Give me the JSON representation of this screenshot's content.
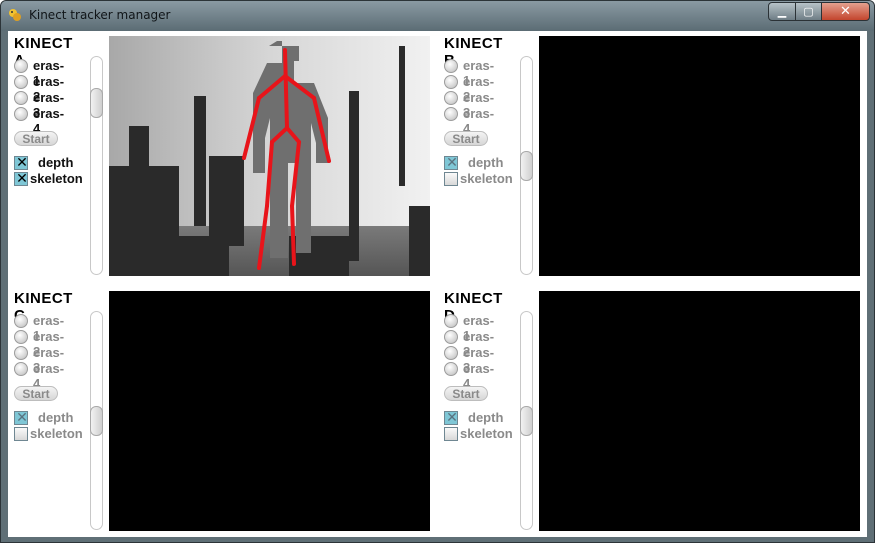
{
  "window": {
    "title": "Kinect tracker manager"
  },
  "controls": {
    "minimize": "▁",
    "maximize": "▢",
    "close": "✕"
  },
  "panels": [
    {
      "title": "KINECT A",
      "eras": [
        "eras-1",
        "eras-2",
        "eras-3",
        "eras-4"
      ],
      "start": "Start",
      "depth": "depth",
      "skeleton": "skeleton",
      "depth_checked": true,
      "skeleton_checked": true,
      "active": true
    },
    {
      "title": "KINECT B",
      "eras": [
        "eras-1",
        "eras-2",
        "eras-3",
        "eras-4"
      ],
      "start": "Start",
      "depth": "depth",
      "skeleton": "skeleton",
      "depth_checked": true,
      "skeleton_checked": false,
      "active": false
    },
    {
      "title": "KINECT C",
      "eras": [
        "eras-1",
        "eras-2",
        "eras-3",
        "eras-4"
      ],
      "start": "Start",
      "depth": "depth",
      "skeleton": "skeleton",
      "depth_checked": true,
      "skeleton_checked": false,
      "active": false
    },
    {
      "title": "KINECT D",
      "eras": [
        "eras-1",
        "eras-2",
        "eras-3",
        "eras-4"
      ],
      "start": "Start",
      "depth": "depth",
      "skeleton": "skeleton",
      "depth_checked": true,
      "skeleton_checked": false,
      "active": false
    }
  ],
  "colors": {
    "skeleton": "#e8141a",
    "checkbox_checked": "#7fc7d6",
    "video_bg": "#000000"
  }
}
